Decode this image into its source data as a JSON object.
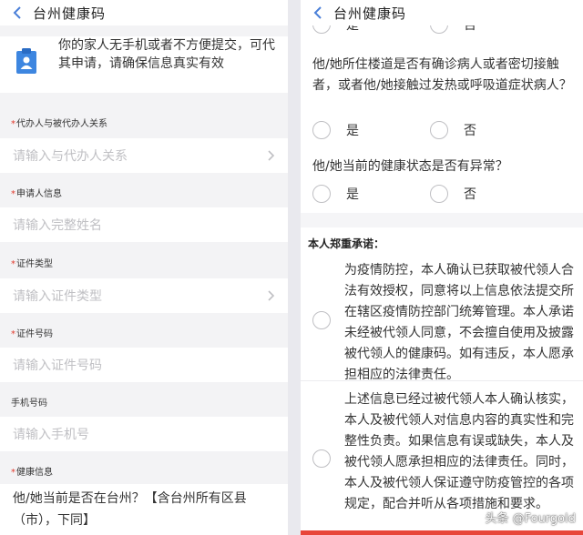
{
  "left": {
    "title": "台州健康码",
    "notice": "你的家人无手机或者不方便提交，可代其申请，请确保信息真实有效",
    "fields": [
      {
        "label": "代办人与被代办人关系",
        "required": true,
        "placeholder": "请输入与代办人关系"
      },
      {
        "label": "申请人信息",
        "required": true,
        "placeholder": "请输入完整姓名"
      },
      {
        "label": "证件类型",
        "required": true,
        "placeholder": "请输入证件类型"
      },
      {
        "label": "证件号码",
        "required": true,
        "placeholder": "请输入证件号码"
      },
      {
        "label": "手机号码",
        "required": false,
        "placeholder": "请输入手机号"
      }
    ],
    "health_label": "健康信息",
    "question": "他/她当前是否在台州？【含台州所有区县（市），下同】"
  },
  "right": {
    "title": "台州健康码",
    "partial_yes": "是",
    "partial_no": "否",
    "q1": "他/她所住楼道是否有确诊病人或者密切接触者，或者他/她接触过发热或呼吸道症状病人？",
    "q1_yes": "是",
    "q1_no": "否",
    "q2": "他/她当前的健康状态是否有异常？",
    "q2_yes": "是",
    "q2_no": "否",
    "pledge_title": "本人郑重承诺：",
    "pledge1": "为疫情防控，本人确认已获取被代领人合法有效授权，同意将以上信息依法提交所在辖区疫情防控部门统筹管理。本人承诺未经被代领人同意，不会擅自使用及披露被代领人的健康码。如有违反，本人愿承担相应的法律责任。",
    "pledge2": "上述信息已经过被代领人本人确认核实，本人及被代领人对信息内容的真实性和完整性负责。如果信息有误或缺失，本人及被代领人愿承担相应的法律责任。同时，本人及被代领人保证遵守防疫管控的各项规定，配合并听从各项措施和要求。"
  },
  "watermark": "头条 @Fourgold",
  "colors": {
    "required": "#e23b2e",
    "accent": "#2f6fe0",
    "placeholder": "#c0c0c4",
    "bottom_strip": "#e8463a"
  },
  "icons": [
    "chevron-left-icon",
    "clipboard-user-icon",
    "chevron-right-icon"
  ]
}
